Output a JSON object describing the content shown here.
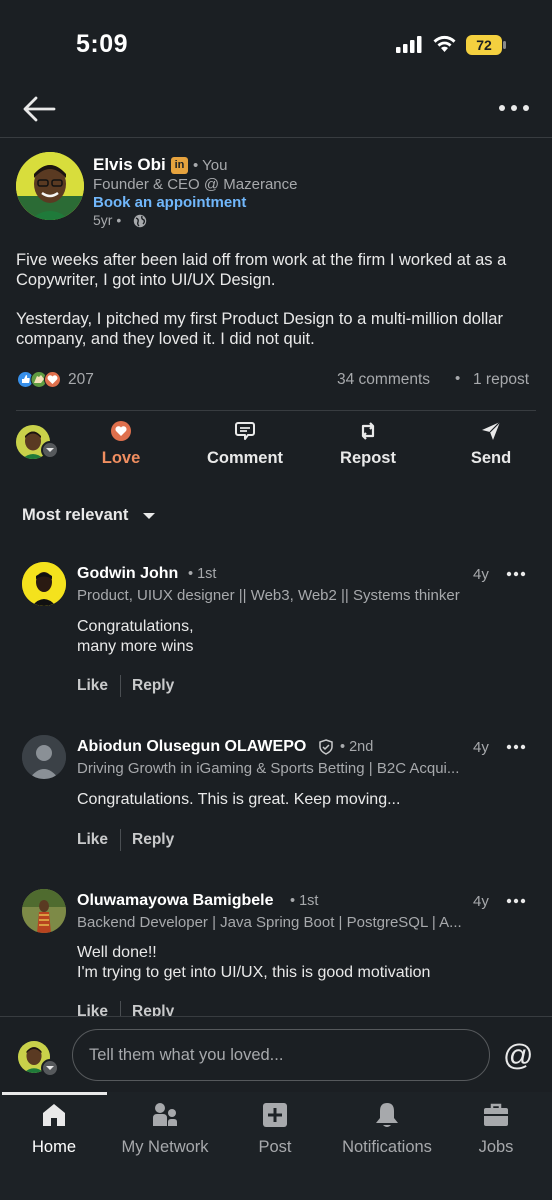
{
  "status_bar": {
    "time": "5:09",
    "battery": "72"
  },
  "post": {
    "author": {
      "name": "Elvis Obi",
      "badge": "in",
      "relation": "• You",
      "headline": "Founder & CEO @ Mazerance",
      "link_label": "Book an appointment",
      "age": "5yr •"
    },
    "body": [
      "Five weeks after been laid off from work at the firm I worked at as a Copywriter, I got into UI/UX Design.",
      "Yesterday, I pitched my first Product Design to a multi-million dollar company, and they loved it. I did not quit."
    ],
    "reaction_count": "207",
    "comments_count": "34 comments",
    "separator": "•",
    "repost_count": "1 repost",
    "reaction_colors": {
      "like": "#378fe9",
      "celebrate": "#5f9b41",
      "love": "#df704d"
    }
  },
  "actions": [
    {
      "label": "Love",
      "icon": "love-icon",
      "color": "#f08e60"
    },
    {
      "label": "Comment",
      "icon": "comment-icon"
    },
    {
      "label": "Repost",
      "icon": "repost-icon"
    },
    {
      "label": "Send",
      "icon": "send-icon"
    }
  ],
  "sort_label": "Most relevant",
  "comments": [
    {
      "name": "Godwin John",
      "degree": "• 1st",
      "time": "4y",
      "headline": "Product, UIUX designer || Web3, Web2 || Systems thinker",
      "text_lines": [
        "Congratulations,",
        "many more wins"
      ],
      "like": "Like",
      "reply": "Reply"
    },
    {
      "name": "Abiodun Olusegun OLAWEPO",
      "degree": "• 2nd",
      "time": "4y",
      "headline": "Driving Growth in iGaming & Sports Betting | B2C Acqui...",
      "text_lines": [
        "Congratulations. This is great. Keep moving..."
      ],
      "like": "Like",
      "reply": "Reply"
    },
    {
      "name": "Oluwamayowa Bamigbele",
      "degree": "• 1st",
      "time": "4y",
      "headline": "Backend Developer | Java Spring Boot | PostgreSQL | A...",
      "text_lines": [
        "Well done!!",
        "I'm trying to get into UI/UX, this is good motivation"
      ],
      "like": "Like",
      "reply": "Reply"
    }
  ],
  "composer": {
    "placeholder": "Tell them what you loved...",
    "mention": "@"
  },
  "bottom_nav": [
    {
      "label": "Home",
      "icon": "home-icon",
      "active": true
    },
    {
      "label": "My Network",
      "icon": "network-icon"
    },
    {
      "label": "Post",
      "icon": "post-icon"
    },
    {
      "label": "Notifications",
      "icon": "bell-icon"
    },
    {
      "label": "Jobs",
      "icon": "briefcase-icon"
    }
  ]
}
